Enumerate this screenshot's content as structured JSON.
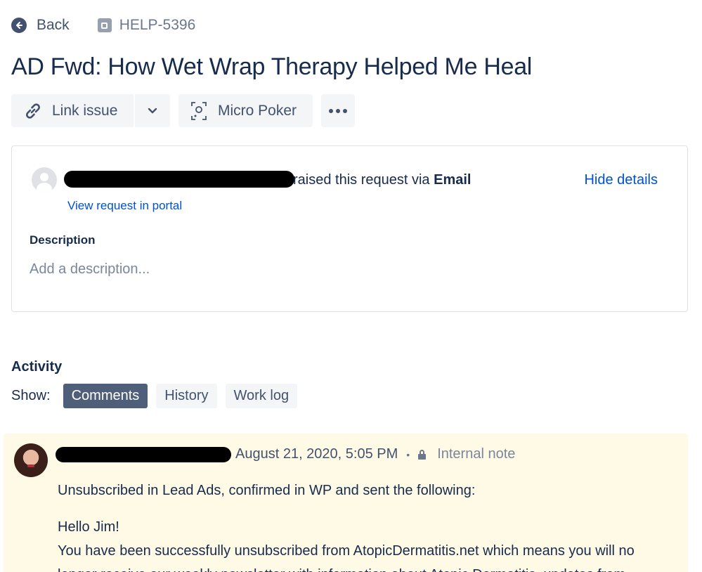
{
  "nav": {
    "back_label": "Back",
    "issue_key": "HELP-5396"
  },
  "issue": {
    "title": "AD Fwd: How Wet Wrap Therapy Helped Me Heal"
  },
  "actions": {
    "link_issue_label": "Link issue",
    "micro_poker_label": "Micro Poker"
  },
  "details": {
    "raised_text": "raised this request via ",
    "channel": "Email",
    "hide_details_label": "Hide details",
    "portal_link_label": "View request in portal",
    "description_label": "Description",
    "description_placeholder": "Add a description..."
  },
  "activity": {
    "label": "Activity",
    "show_label": "Show:",
    "filters": [
      "Comments",
      "History",
      "Work log"
    ],
    "active_filter": "Comments"
  },
  "comment": {
    "timestamp": "August 21, 2020, 5:05 PM",
    "visibility": "Internal note",
    "lines": [
      "Unsubscribed in Lead Ads, confirmed in WP and sent the following:",
      "Hello Jim!",
      "You have been successfully unsubscribed from AtopicDermatitis.net which means you will no",
      "longer receive our weekly newsletter with information about Atopic Dermatitis, updates from"
    ]
  },
  "colors": {
    "text_primary": "#172b4d",
    "link_blue": "#0052cc",
    "note_background": "#fffae6",
    "active_filter_bg": "#505f79",
    "button_bg": "#f4f5f7"
  },
  "icons": [
    "arrow-left-circle-icon",
    "issue-type-icon",
    "link-icon",
    "chevron-down-icon",
    "scan-icon",
    "more-icon",
    "lock-icon",
    "avatar-icon"
  ]
}
